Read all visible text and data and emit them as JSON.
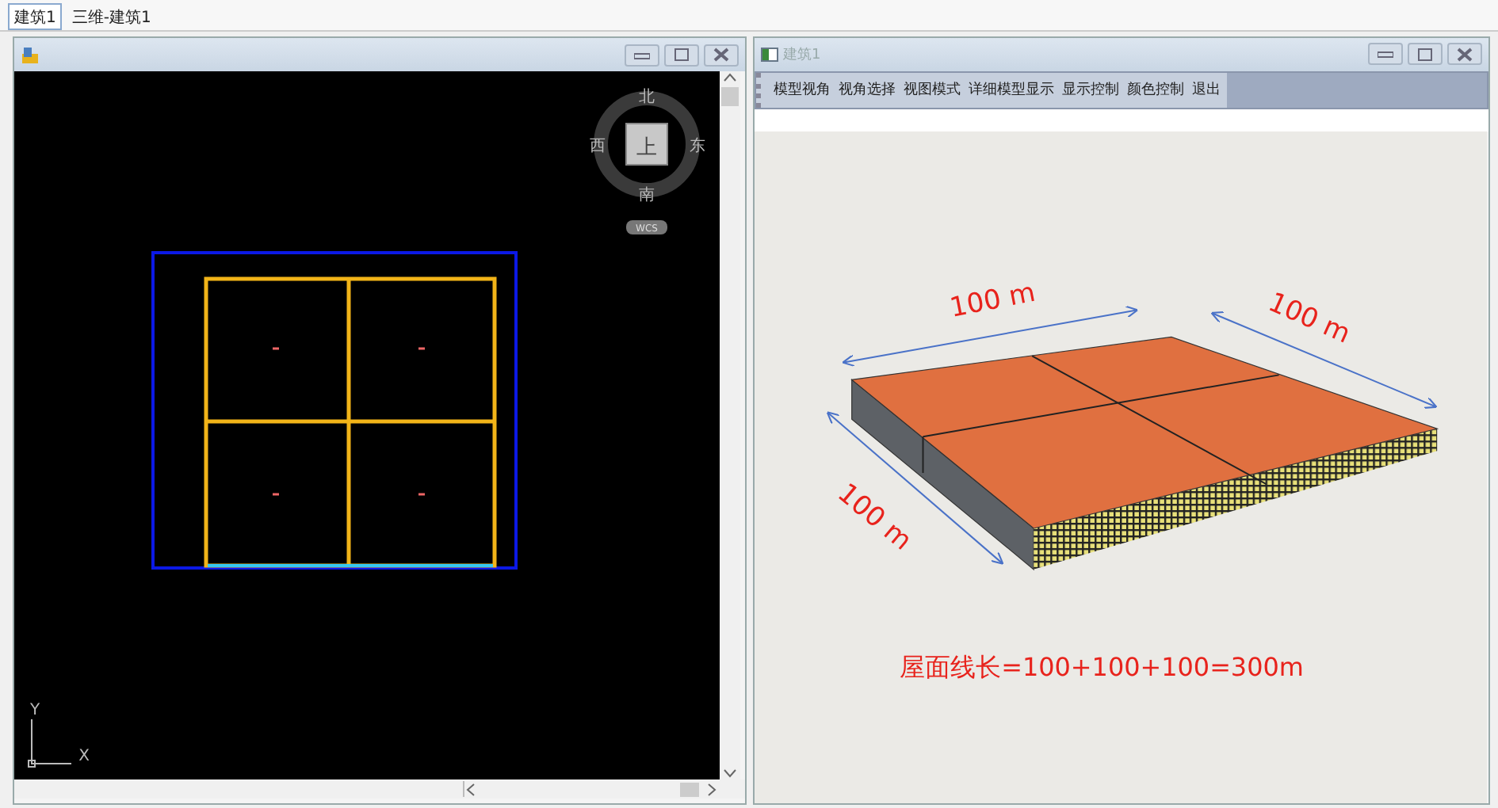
{
  "tabs": [
    {
      "label": "建筑1",
      "selected": true
    },
    {
      "label": "三维-建筑1",
      "selected": false
    }
  ],
  "plan_window": {
    "compass": {
      "north": "北",
      "south": "南",
      "west": "西",
      "east": "东",
      "view": "上",
      "coordinate_system": "WCS"
    },
    "axis_labels": [
      "Y",
      "X"
    ]
  },
  "model_window": {
    "title": "建筑1",
    "menu": [
      "模型视角",
      "视角选择",
      "视图模式",
      "详细模型显示",
      "显示控制",
      "颜色控制",
      "退出"
    ],
    "dimension_labels": [
      "100 m",
      "100 m",
      "100 m"
    ],
    "formula": "屋面线长=100+100+100=300m"
  }
}
